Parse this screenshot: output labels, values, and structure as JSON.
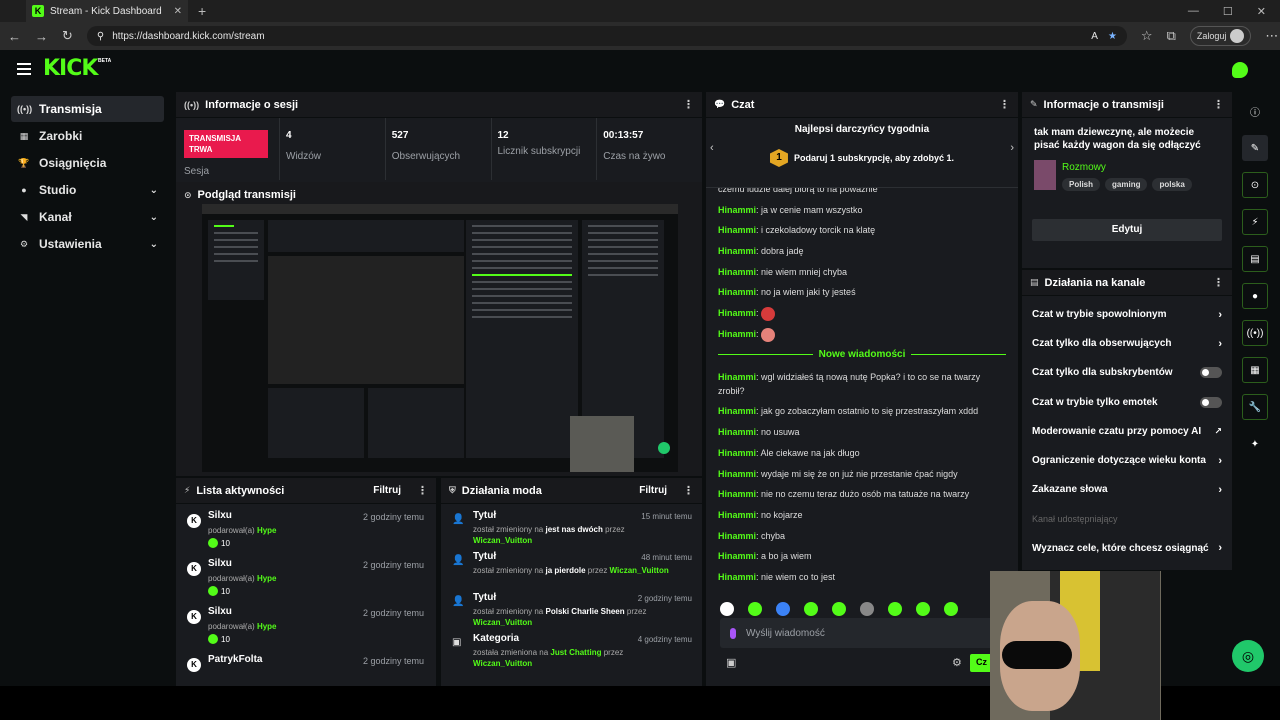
{
  "browser": {
    "tab_title": "Stream - Kick Dashboard",
    "url": "https://dashboard.kick.com/stream",
    "login": "Zaloguj"
  },
  "brand": {
    "logo": "KICK",
    "beta": "BETA",
    "accent": "#53fc18"
  },
  "nav": {
    "items": [
      "Transmisja",
      "Zarobki",
      "Osiągnięcia",
      "Studio",
      "Kanał",
      "Ustawienia"
    ]
  },
  "session": {
    "title": "Informacje o sesji",
    "live_label": "TRANSMISJA TRWA",
    "session_label": "Sesja",
    "stats": [
      {
        "n": "4",
        "l": "Widzów"
      },
      {
        "n": "527",
        "l": "Obserwujących"
      },
      {
        "n": "12",
        "l": "Licznik subskrypcji"
      },
      {
        "n": "00:13:57",
        "l": "Czas na żywo"
      }
    ]
  },
  "preview": {
    "title": "Podgląd transmisji"
  },
  "activity": {
    "title": "Lista aktywności",
    "filter": "Filtruj",
    "gifted": "podarował(a)",
    "hype": "Hype",
    "rows": [
      {
        "name": "Silxu",
        "time": "2 godziny temu",
        "count": "10"
      },
      {
        "name": "Silxu",
        "time": "2 godziny temu",
        "count": "10"
      },
      {
        "name": "Silxu",
        "time": "2 godziny temu",
        "count": "10"
      },
      {
        "name": "PatrykFolta",
        "time": "2 godziny temu"
      }
    ]
  },
  "mod": {
    "title": "Działania moda",
    "filter": "Filtruj",
    "rows": [
      {
        "name": "Tytuł",
        "time": "15 minut temu",
        "pre": "został zmieniony na",
        "val": "jest nas dwóch",
        "by": "przez",
        "user": "Wiczan_Vuitton"
      },
      {
        "name": "Tytuł",
        "time": "48 minut temu",
        "pre": "został zmieniony na",
        "val": "ja pierdole",
        "by": "przez",
        "user": "Wiczan_Vuitton"
      },
      {
        "name": "Tytuł",
        "time": "2 godziny temu",
        "pre": "został zmieniony na",
        "val": "Polski Charlie Sheen",
        "by": "przez",
        "user": "Wiczan_Vuitton"
      },
      {
        "name": "Kategoria",
        "time": "4 godziny temu",
        "pre": "została zmieniona na",
        "val": "Just Chatting",
        "by": "przez",
        "user": "Wiczan_Vuitton"
      }
    ]
  },
  "chat": {
    "title": "Czat",
    "top_title": "Najlepsi darczyńcy tygodnia",
    "promo": "Podaruj 1 subskrypcję, aby zdobyć 1.",
    "medal": "1",
    "cut": "czemu ludzie dalej biorą to na poważnie",
    "new_label": "Nowe wiadomości",
    "user": "Hinammi",
    "before": [
      "ja w cenie mam wszystko",
      "i czekoladowy torcik na klatę",
      "dobra jadę",
      "nie wiem mniej chyba",
      "no ja wiem jaki ty jesteś",
      "",
      ""
    ],
    "after": [
      "wgl widziałeś tą nową nutę Popka? i to co se na twarzy zrobił?",
      "jak go zobaczyłam ostatnio to się przestraszyłam xddd",
      "no usuwa",
      "Ale ciekawe na jak długo",
      "wydaje mi się że on już nie przestanie ćpać nigdy",
      "nie no czemu teraz dużo osób ma tatuaże na twarzy",
      "no kojarze",
      "chyba",
      "a bo ja wiem",
      "nie wiem co to jest"
    ],
    "placeholder": "Wyślij wiadomość",
    "send": "Cz"
  },
  "stream_info": {
    "title": "Informacje o transmisji",
    "stream_title": "tak mam dziewczynę, ale możecie pisać każdy wagon da się odłączyć",
    "category": "Rozmowy",
    "tags": [
      "Polish",
      "gaming",
      "polska"
    ],
    "edit": "Edytuj"
  },
  "channel": {
    "title": "Działania na kanale",
    "rows": [
      {
        "label": "Czat w trybie spowolnionym",
        "kind": "chev"
      },
      {
        "label": "Czat tylko dla obserwujących",
        "kind": "chev"
      },
      {
        "label": "Czat tylko dla subskrybentów",
        "kind": "toggle",
        "on": false
      },
      {
        "label": "Czat w trybie tylko emotek",
        "kind": "toggle",
        "on": false
      },
      {
        "label": "Moderowanie czatu przy pomocy AI",
        "kind": "ext"
      },
      {
        "label": "Ograniczenie dotyczące wieku konta",
        "kind": "chev"
      },
      {
        "label": "Zakazane słowa",
        "kind": "chev"
      },
      {
        "label": "Kanał udostępniający",
        "kind": "dim"
      },
      {
        "label": "Wyznacz cele, które chcesz osiągnąć",
        "kind": "chev"
      }
    ]
  }
}
